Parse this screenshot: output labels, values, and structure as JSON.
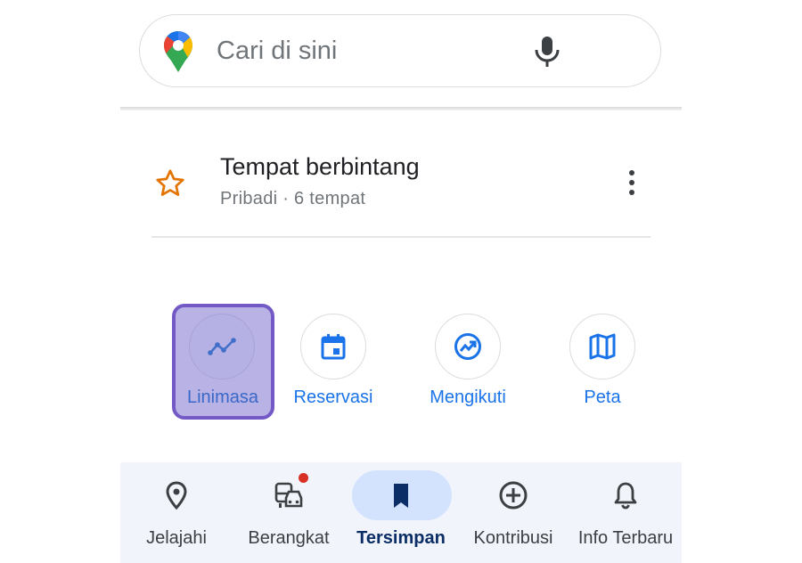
{
  "search": {
    "placeholder": "Cari di sini"
  },
  "saved_list": {
    "title": "Tempat berbintang",
    "subtitle": "Pribadi · 6 tempat"
  },
  "shortcuts": [
    {
      "label": "Linimasa",
      "icon": "timeline-icon",
      "highlighted": true
    },
    {
      "label": "Reservasi",
      "icon": "calendar-icon"
    },
    {
      "label": "Mengikuti",
      "icon": "trending-icon"
    },
    {
      "label": "Peta",
      "icon": "map-icon"
    }
  ],
  "bottom_nav": {
    "items": [
      {
        "label": "Jelajahi",
        "icon": "location-pin-icon"
      },
      {
        "label": "Berangkat",
        "icon": "commute-icon",
        "badge": true
      },
      {
        "label": "Tersimpan",
        "icon": "bookmark-icon",
        "active": true
      },
      {
        "label": "Kontribusi",
        "icon": "add-circle-icon"
      },
      {
        "label": "Info Terbaru",
        "icon": "bell-icon"
      }
    ]
  },
  "colors": {
    "accent_blue": "#1a73e8",
    "star_orange": "#e37400",
    "highlight_purple": "#7259c5",
    "nav_active_pill": "#d3e3fd",
    "badge_red": "#d93025"
  }
}
